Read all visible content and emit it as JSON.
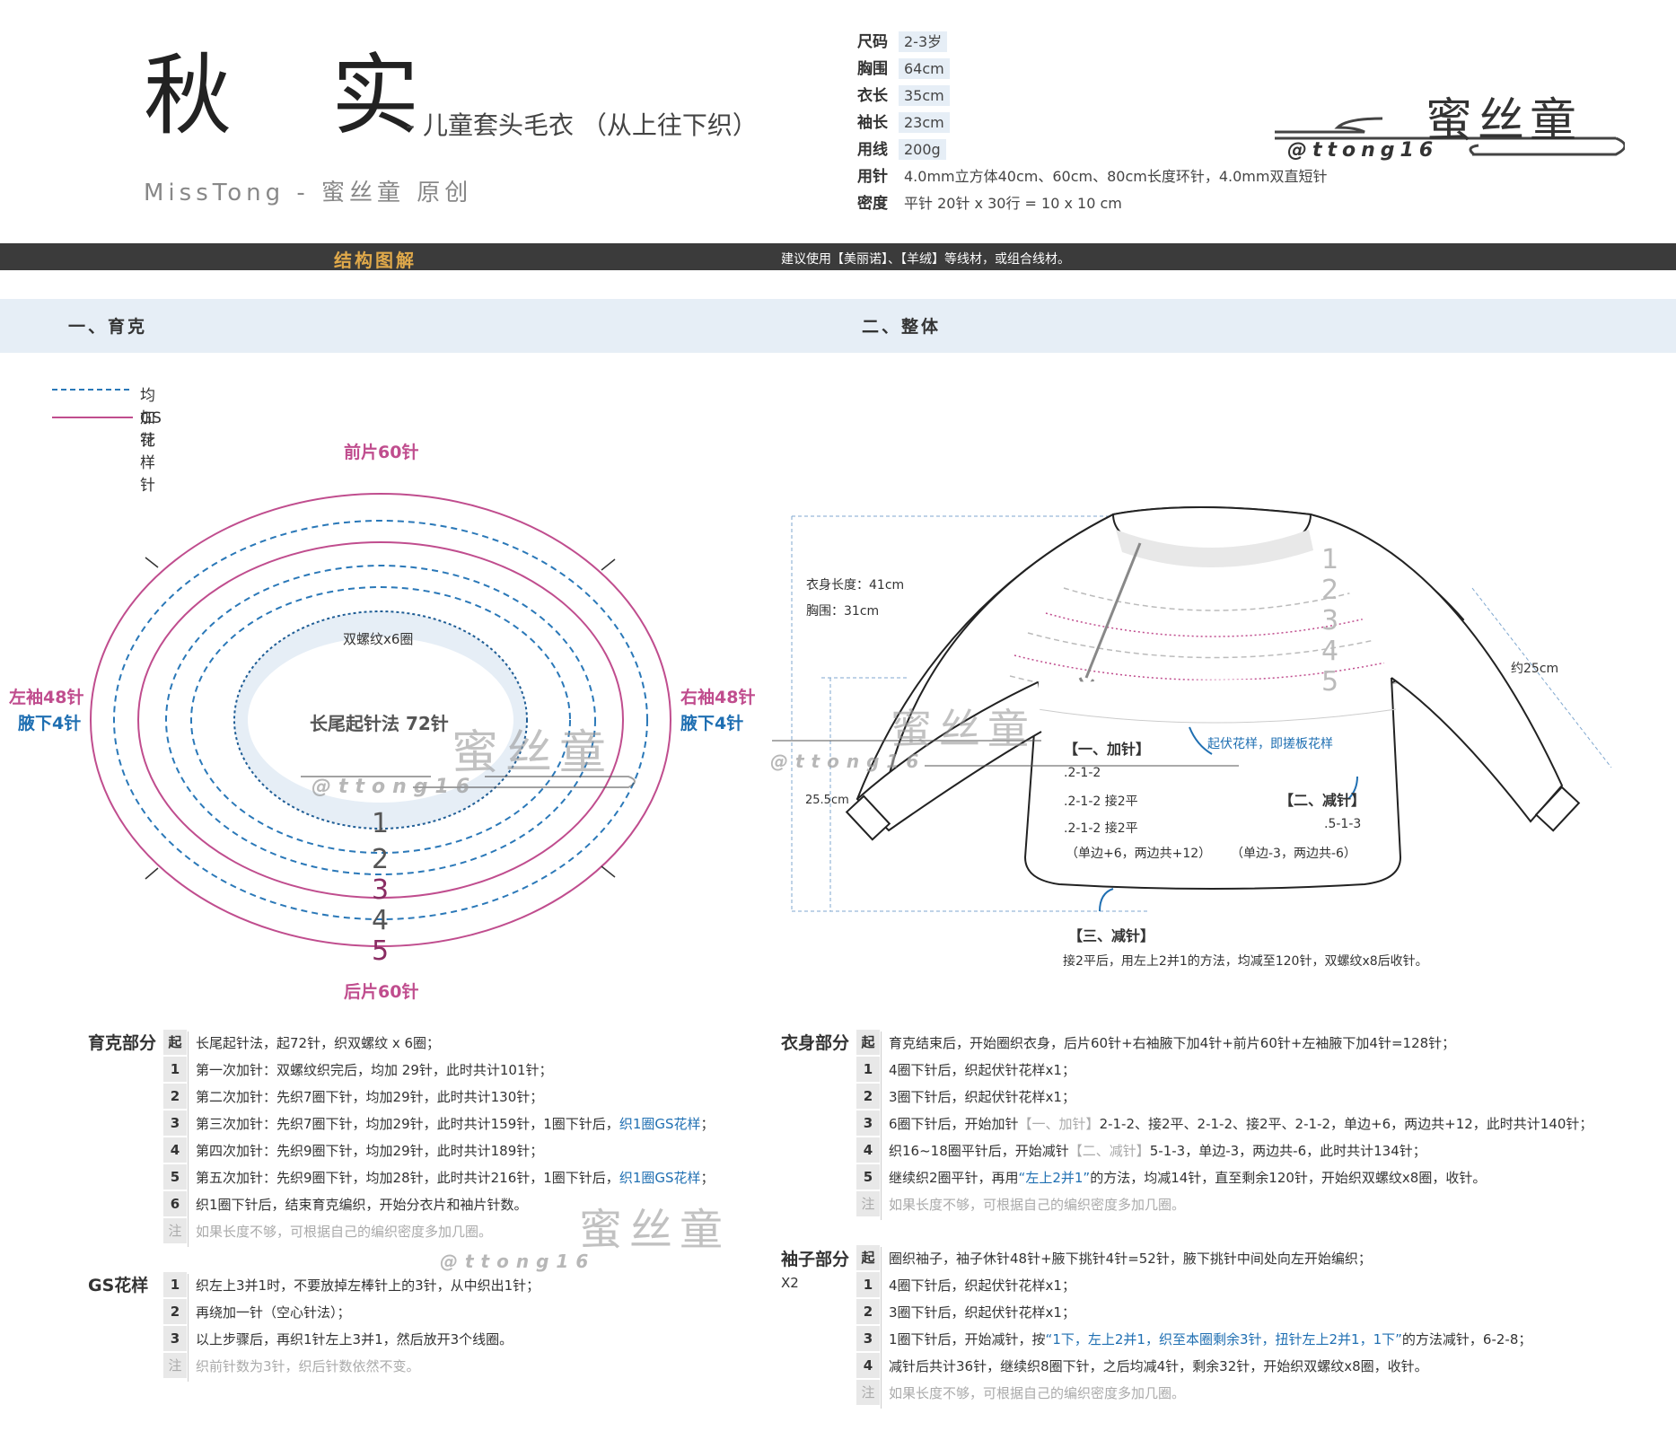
{
  "header": {
    "title": "秋 实",
    "subtitle": "- 儿童套头毛衣 （从上往下织）",
    "brand_line": "MissTong - 蜜丝童 原创",
    "logo_text": "蜜丝童",
    "logo_handle": "@ttong16"
  },
  "specs": [
    {
      "label": "尺码",
      "value": "2-3岁",
      "highlight": true
    },
    {
      "label": "胸围",
      "value": "64cm",
      "highlight": true
    },
    {
      "label": "衣长",
      "value": "35cm",
      "highlight": true
    },
    {
      "label": "袖长",
      "value": "23cm",
      "highlight": true
    },
    {
      "label": "用线",
      "value": "200g",
      "highlight": true
    },
    {
      "label": "用针",
      "value": "4.0mm立方体40cm、60cm、80cm长度环针，4.0mm双直短针",
      "highlight": false
    },
    {
      "label": "密度",
      "value": "平针 20针 x 30行 = 10 x 10 cm",
      "highlight": false
    }
  ],
  "bar": {
    "title": "结构图解",
    "note": "建议使用【美丽诺】、【羊绒】等线材，或组合线材。"
  },
  "sections": {
    "yoke": "一、育克",
    "whole": "二、整体"
  },
  "legend": {
    "dashed": "均加针",
    "solid": "GS花样针"
  },
  "yoke_diagram": {
    "front": "前片60针",
    "back": "后片60针",
    "left_sleeve": "左袖48针",
    "left_underarm": "腋下4针",
    "right_sleeve": "右袖48针",
    "right_underarm": "腋下4针",
    "inner_label": "双螺纹x6圈",
    "center_label": "长尾起针法 72针",
    "rings": [
      "1",
      "2",
      "3",
      "4",
      "5"
    ]
  },
  "body_diagram": {
    "body_length": "衣身长度：41cm",
    "chest": "胸围：31cm",
    "sleeve_len": "约25cm",
    "height_25": "25.5cm",
    "yoke_nums": [
      "1",
      "2",
      "3",
      "4",
      "5"
    ],
    "raised_note": "起伏花样，即搓板花样",
    "inc_title": "【一、加针】",
    "inc_lines": [
      ".2-1-2",
      ".2-1-2  接2平",
      ".2-1-2  接2平",
      "（单边+6，两边共+12）"
    ],
    "dec_title": "【二、减针】",
    "dec_lines": [
      ".5-1-3",
      "（单边-3，两边共-6）"
    ],
    "dec3_title": "【三、减针】",
    "dec3_note": "接2平后，用左上2并1的方法，均减至120针，双螺纹x8后收针。"
  },
  "yoke_steps": {
    "title": "育克部分",
    "rows": [
      {
        "n": "起",
        "text": "长尾起针法，起72针，织双螺纹 x 6圈；"
      },
      {
        "n": "1",
        "text": "第一次加针：双螺纹织完后，均加 29针，此时共计101针；"
      },
      {
        "n": "2",
        "text": "第二次加针：先织7圈下针，均加29针，此时共计130针；"
      },
      {
        "n": "3",
        "text": "第三次加针：先织7圈下针，均加29针，此时共计159针，1圈下针后，",
        "blue": "织1圈GS花样",
        "tail": "；"
      },
      {
        "n": "4",
        "text": "第四次加针：先织9圈下针，均加29针，此时共计189针；"
      },
      {
        "n": "5",
        "text": "第五次加针：先织9圈下针，均加28针，此时共计216针，1圈下针后，",
        "blue": "织1圈GS花样",
        "tail": "；"
      },
      {
        "n": "6",
        "text": "织1圈下针后，结束育克编织，开始分衣片和袖片针数。"
      },
      {
        "n": "注",
        "text": "如果长度不够，可根据自己的编织密度多加几圈。",
        "grey": true
      }
    ]
  },
  "gs_steps": {
    "title": "GS花样",
    "rows": [
      {
        "n": "1",
        "text": "织左上3并1时，不要放掉左棒针上的3针，从中织出1针；"
      },
      {
        "n": "2",
        "text": "再绕加一针（空心针法）；"
      },
      {
        "n": "3",
        "text": "以上步骤后，再织1针左上3并1，然后放开3个线圈。"
      },
      {
        "n": "注",
        "text": "织前针数为3针，织后针数依然不变。",
        "grey": true
      }
    ]
  },
  "body_steps": {
    "title": "衣身部分",
    "rows": [
      {
        "n": "起",
        "text": "育克结束后，开始圈织衣身，后片60针+右袖腋下加4针+前片60针+左袖腋下加4针=128针；"
      },
      {
        "n": "1",
        "text": "4圈下针后，织起伏针花样x1；"
      },
      {
        "n": "2",
        "text": "3圈下针后，织起伏针花样x1；"
      },
      {
        "n": "3",
        "text": "6圈下针后，开始加针",
        "grey_mid": "【一、加针】",
        "tail": "2-1-2、接2平、2-1-2、接2平、2-1-2，单边+6，两边共+12，此时共计140针；"
      },
      {
        "n": "4",
        "text": "织16~18圈平针后，开始减针",
        "grey_mid": "【二、减针】",
        "tail": "5-1-3，单边-3，两边共-6，此时共计134针；"
      },
      {
        "n": "5",
        "text": "继续织2圈平针，再用",
        "blue": "“左上2并1”",
        "tail": "的方法，均减14针，直至剩余120针，开始织双螺纹x8圈，收针。"
      },
      {
        "n": "注",
        "text": "如果长度不够，可根据自己的编织密度多加几圈。",
        "grey": true
      }
    ]
  },
  "sleeve_steps": {
    "title": "袖子部分",
    "multiplier": "X2",
    "rows": [
      {
        "n": "起",
        "text": "圈织袖子，袖子休针48针+腋下挑针4针=52针，腋下挑针中间处向左开始编织；"
      },
      {
        "n": "1",
        "text": "4圈下针后，织起伏针花样x1；"
      },
      {
        "n": "2",
        "text": "3圈下针后，织起伏针花样x1；"
      },
      {
        "n": "3",
        "text": "1圈下针后，开始减针，按",
        "blue": "“1下，左上2并1，织至本圈剩余3针，扭针左上2并1，1下”",
        "tail": "的方法减针，6-2-8；"
      },
      {
        "n": "4",
        "text": "减针后共计36针，继续织8圈下针，之后均减4针，剩余32针，开始织双螺纹x8圈，收针。"
      },
      {
        "n": "注",
        "text": "如果长度不够，可根据自己的编织密度多加几圈。",
        "grey": true
      }
    ]
  },
  "colors": {
    "accent_pink": "#c04d8e",
    "accent_blue": "#1f6fb2",
    "dashed_blue": "#2a78b8",
    "band": "#e6eef6",
    "dark_bar": "#3b3b3b",
    "gold": "#e0a94a"
  }
}
